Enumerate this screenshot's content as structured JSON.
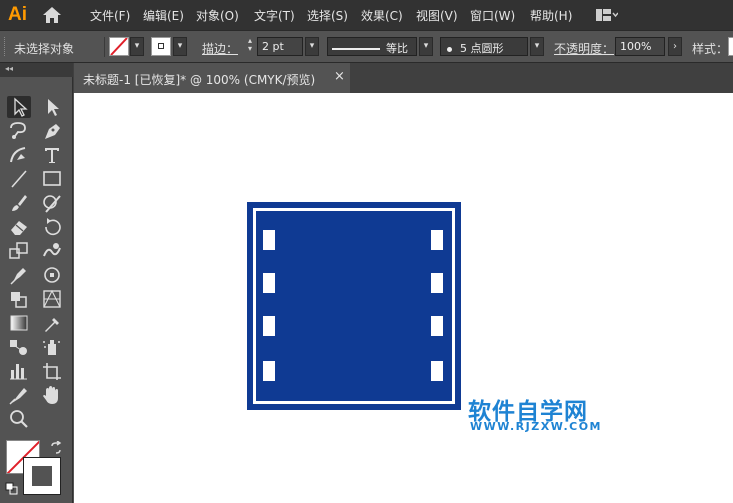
{
  "app": {
    "logo": "Ai"
  },
  "menu": [
    "文件(F)",
    "编辑(E)",
    "对象(O)",
    "文字(T)",
    "选择(S)",
    "效果(C)",
    "视图(V)",
    "窗口(W)",
    "帮助(H)"
  ],
  "control_bar": {
    "selection_label": "未选择对象",
    "stroke_label": "描边：",
    "stroke_value": "2 pt",
    "stroke_profile": "等比",
    "brush_value": "5 点圆形",
    "opacity_label": "不透明度：",
    "opacity_value": "100%",
    "style_label": "样式："
  },
  "document_tab": {
    "title": "未标题-1 [已恢复]* @ 100% (CMYK/预览)",
    "close": "×"
  },
  "panel": {
    "collapse": "◂◂"
  },
  "artwork": {
    "fill_color": "#0f3a93",
    "hole_color": "#ffffff"
  },
  "watermark": {
    "line1": "软件自学网",
    "line2": "WWW.RJZXW.COM"
  },
  "colors": {
    "accent": "#ff9a00",
    "stroke_red": "#e0202a",
    "watermark": "#1e83d3"
  }
}
